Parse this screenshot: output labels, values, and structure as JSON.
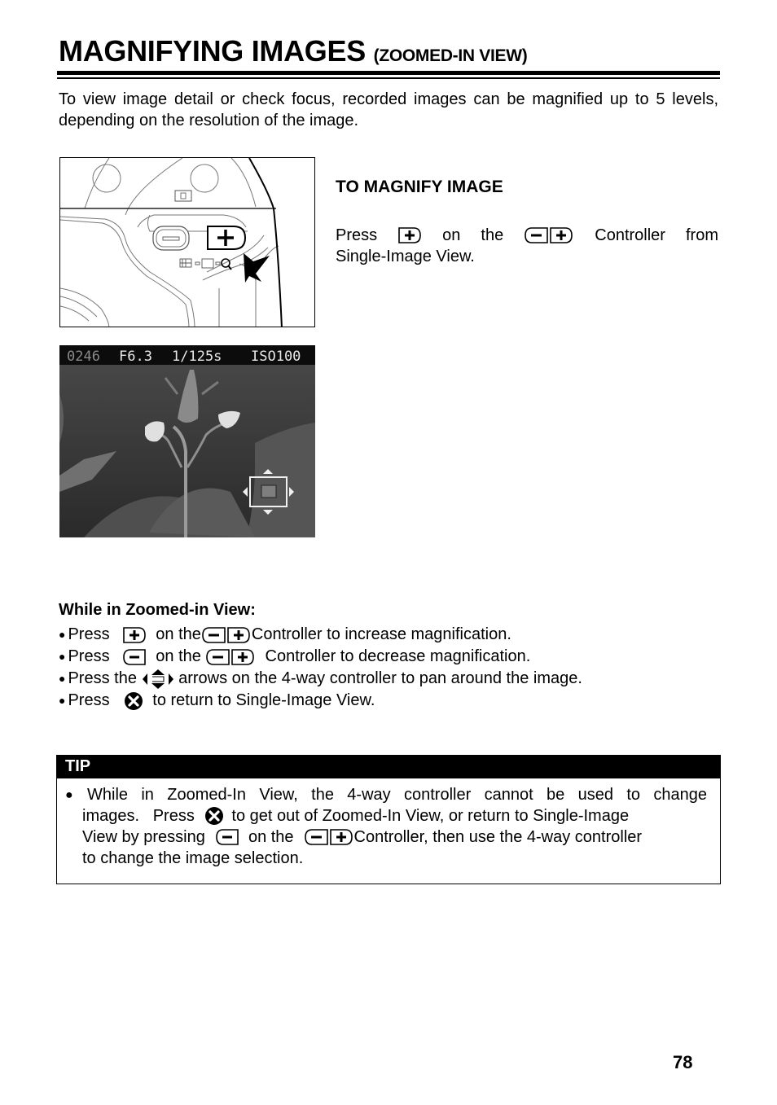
{
  "page": {
    "title": "MAGNIFYING IMAGES",
    "title_suffix": "(ZOOMED-IN VIEW)",
    "intro": "To view image detail or check focus, recorded images can be magnified up to 5 levels, depending on the resolution of the image.",
    "page_number": "78"
  },
  "figures": {
    "lcd_overlay": {
      "frame_number": "0246",
      "aperture": "F6.3",
      "shutter": "1/125s",
      "iso": "ISO100"
    }
  },
  "magnify": {
    "heading": "TO MAGNIFY IMAGE",
    "line1": [
      "Press",
      "on",
      "the",
      "Controller",
      "from"
    ],
    "line2": "Single-Image View."
  },
  "zoomed_in": {
    "heading": "While in Zoomed-in View:",
    "bullets": [
      {
        "pre": "Press ",
        "mid": "  on the",
        "post": "Controller to increase magnification."
      },
      {
        "pre": "Press ",
        "mid": "  on the ",
        "post": "  Controller to decrease magnification."
      },
      {
        "pre": "Press the ",
        "post": " arrows on the 4-way controller to pan around the image."
      },
      {
        "pre": "Press ",
        "post": "  to return to Single-Image View."
      }
    ]
  },
  "tip": {
    "label": "TIP",
    "line1": [
      "While",
      "in",
      "Zoomed-In",
      "View,",
      "the",
      "4-way",
      "controller",
      "cannot",
      "be",
      "used",
      "to",
      "change"
    ],
    "line2_pre": "images.   Press",
    "line2_post": " to get out of Zoomed-In View, or return to Single-Image",
    "line3_pre": "View by pressing",
    "line3_mid": "  on the",
    "line3_post": "Controller, then use the 4-way controller",
    "line4": "to change the image selection."
  },
  "icons": {
    "plus_button": "plus-button-icon",
    "minus_button": "minus-button-icon",
    "minus_plus_controller": "minus-plus-controller-icon",
    "four_way_arrows": "four-way-arrows-icon",
    "cancel_button": "cancel-x-icon"
  }
}
